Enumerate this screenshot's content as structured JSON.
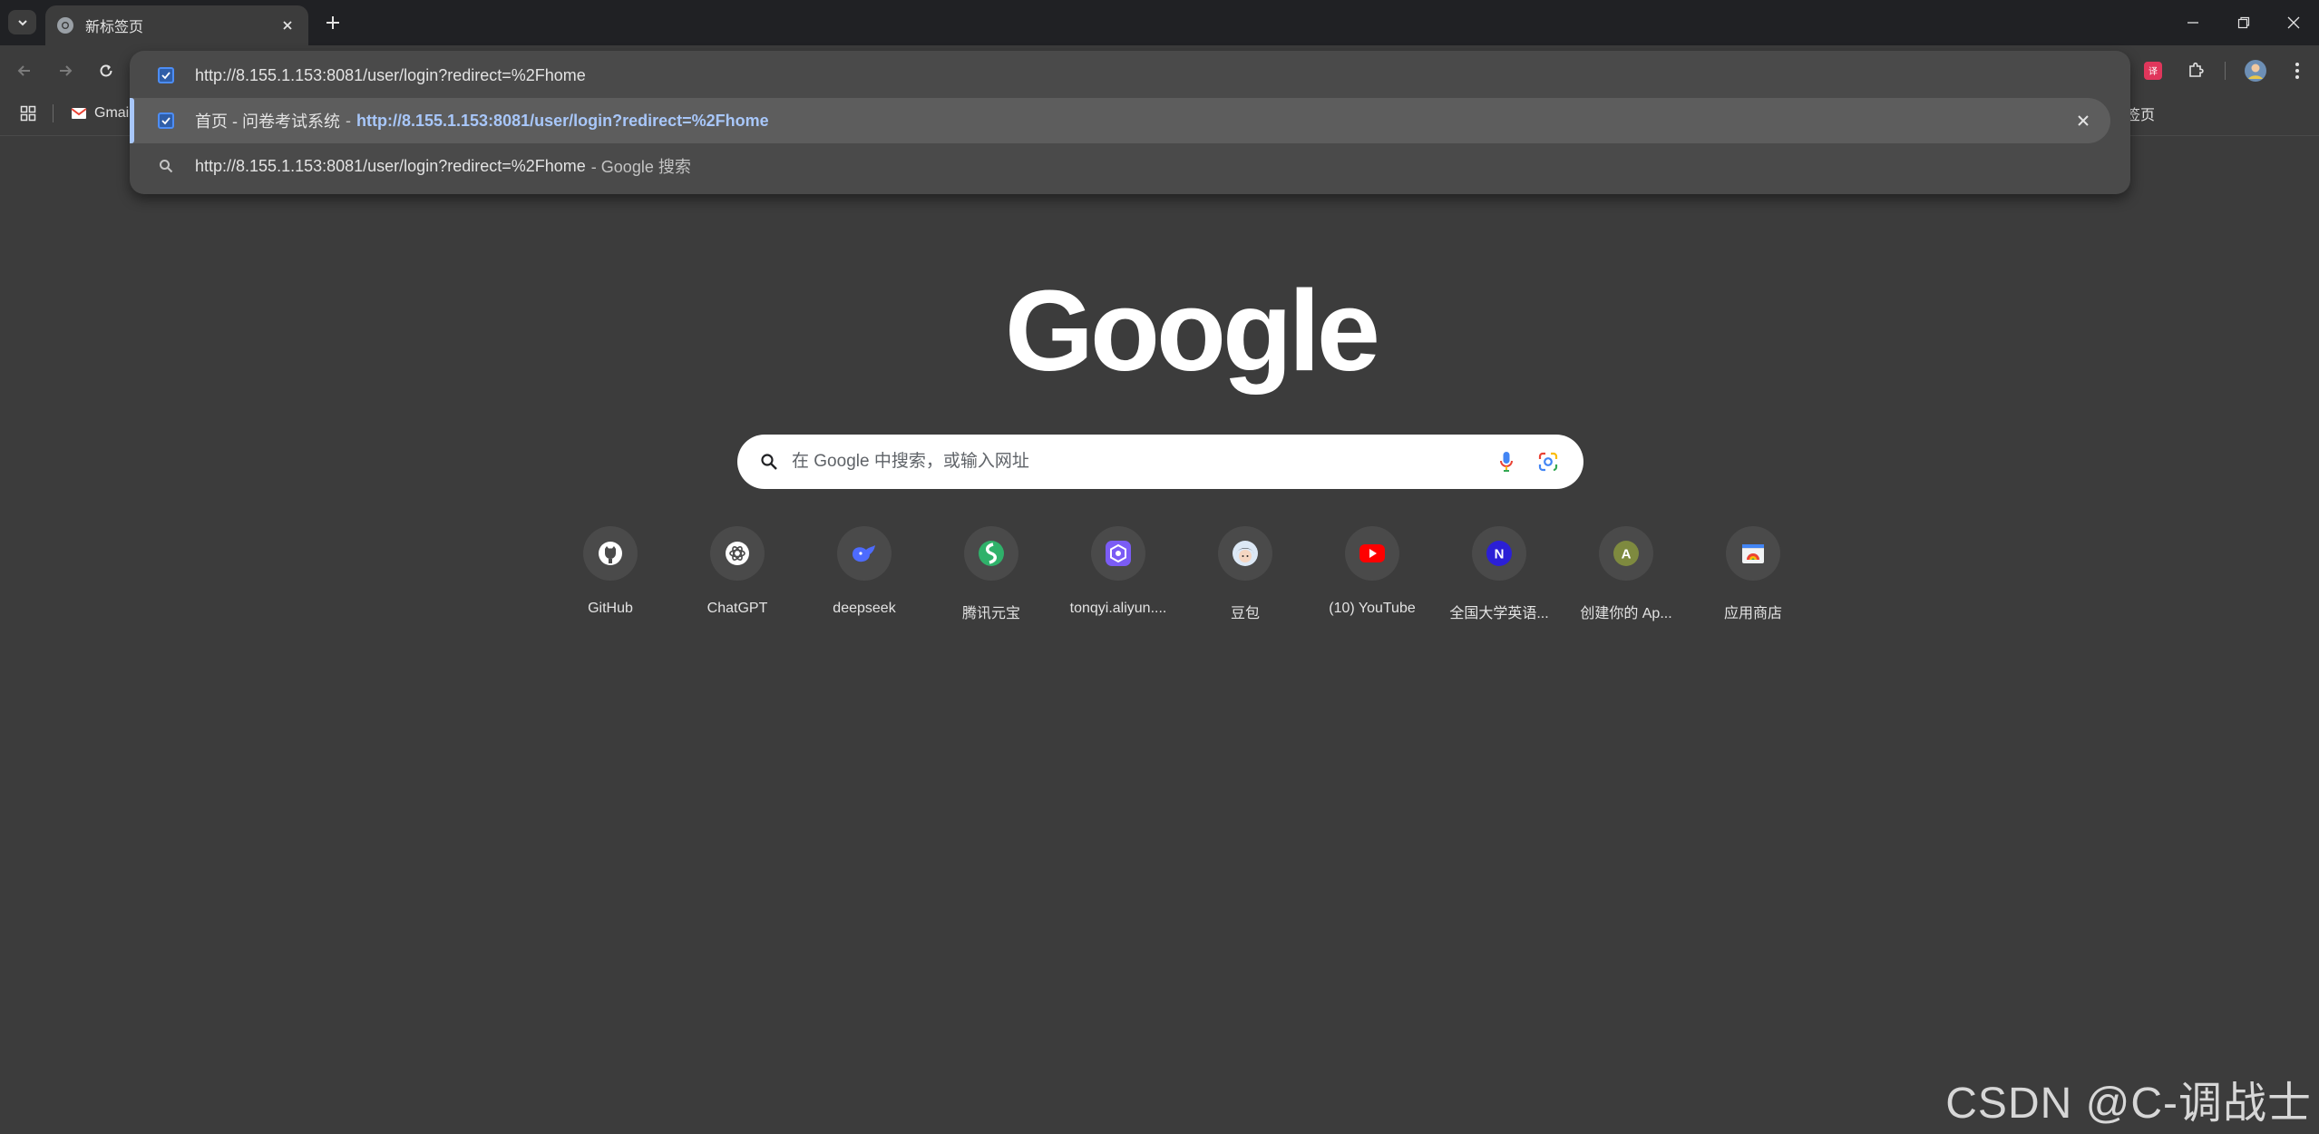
{
  "tab": {
    "title": "新标签页"
  },
  "omnibox": {
    "input": "http://8.155.1.153:8081/user/login?redirect=%2Fhome",
    "suggestion": {
      "page_title": "首页 - 问卷考试系统",
      "separator": "-",
      "url": "http://8.155.1.153:8081/user/login?redirect=%2Fhome"
    },
    "search": {
      "query": "http://8.155.1.153:8081/user/login?redirect=%2Fhome",
      "suffix": "- Google 搜索"
    }
  },
  "bookmarks": {
    "gmail": "Gmai",
    "right": "签页"
  },
  "ntp": {
    "logo": "Google",
    "search_placeholder": "在 Google 中搜索，或输入网址",
    "shortcuts": [
      {
        "label": "GitHub",
        "icon": "github-icon"
      },
      {
        "label": "ChatGPT",
        "icon": "chatgpt-icon"
      },
      {
        "label": "deepseek",
        "icon": "deepseek-icon"
      },
      {
        "label": "腾讯元宝",
        "icon": "yuanbao-icon"
      },
      {
        "label": "tonqyi.aliyun....",
        "icon": "tongyi-icon"
      },
      {
        "label": "豆包",
        "icon": "doubao-icon"
      },
      {
        "label": "(10) YouTube",
        "icon": "youtube-icon"
      },
      {
        "label": "全国大学英语...",
        "icon": "letter-n-icon",
        "letter": "N"
      },
      {
        "label": "创建你的 Ap...",
        "icon": "letter-a-icon",
        "letter": "A"
      },
      {
        "label": "应用商店",
        "icon": "webstore-icon"
      }
    ]
  },
  "watermark": "CSDN @C-调战士",
  "colors": {
    "background": "#3c3c3c",
    "tabstrip": "#202124",
    "accent": "#a8c7fa",
    "youtube_red": "#ff0000"
  }
}
